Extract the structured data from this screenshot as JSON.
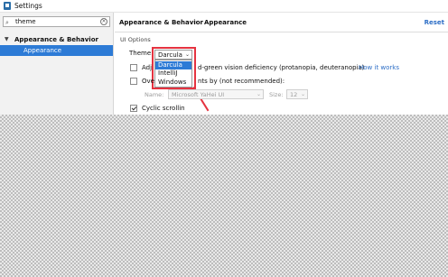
{
  "window": {
    "title": "Settings"
  },
  "search": {
    "value": "theme"
  },
  "sidebar": {
    "parent_label": "Appearance & Behavior",
    "child_label": "Appearance"
  },
  "header": {
    "crumb_parent": "Appearance & Behavior",
    "separator": "›",
    "crumb_current": "Appearance",
    "reset_label": "Reset"
  },
  "ui_options": {
    "section_label": "UI Options",
    "theme_label": "Theme:",
    "theme_selected": "Darcula",
    "theme_options": [
      "Darcula",
      "IntelliJ",
      "Windows"
    ],
    "adjust_prefix": "Adj",
    "adjust_suffix": "d-green vision deficiency (protanopia, deuteranopia)",
    "how_it_works": "How it works",
    "override_prefix": "Ove",
    "override_suffix": "nts by (not recommended):",
    "name_label": "Name:",
    "font_name": "Microsoft YaHei UI",
    "size_label": "Size:",
    "font_size": "12",
    "cyclic_prefix": "Cyclic scrollin",
    "adjust_checked": false,
    "override_checked": false,
    "cyclic_checked": true
  },
  "colors": {
    "accent": "#2d7bd6",
    "annotation": "#e53340",
    "link": "#2d6ec6"
  },
  "icons": {
    "search": "search-icon",
    "clear": "clear-icon",
    "chevron": "chevron-down-icon"
  }
}
